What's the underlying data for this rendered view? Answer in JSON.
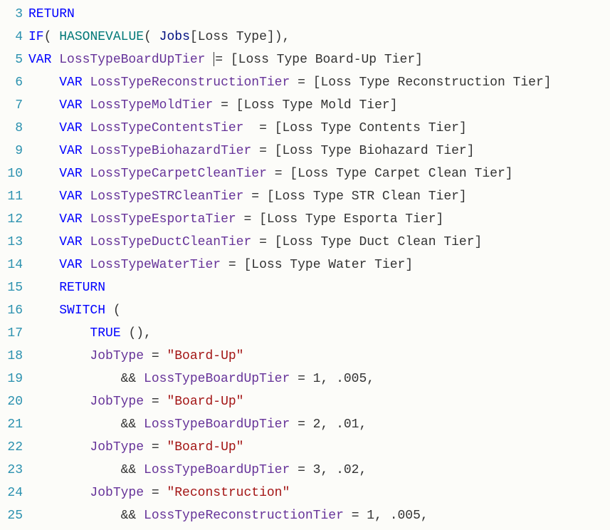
{
  "chart_data": null,
  "lines": [
    {
      "num": "3",
      "indent": 0,
      "tokens": [
        {
          "t": "RETURN",
          "c": "returnkw"
        }
      ]
    },
    {
      "num": "4",
      "indent": 0,
      "tokens": [
        {
          "t": "IF",
          "c": "ifkw"
        },
        {
          "t": "(",
          "c": "paren"
        },
        {
          "t": " ",
          "c": "plain"
        },
        {
          "t": "HASONEVALUE",
          "c": "hasone"
        },
        {
          "t": "( ",
          "c": "paren"
        },
        {
          "t": "Jobs",
          "c": "jobs"
        },
        {
          "t": "[Loss Type]",
          "c": "losstype"
        },
        {
          "t": "),",
          "c": "paren"
        }
      ]
    },
    {
      "num": "5",
      "indent": 0,
      "tokens": [
        {
          "t": "VAR",
          "c": "varkw"
        },
        {
          "t": " ",
          "c": "plain"
        },
        {
          "t": "LossTypeBoardUpTier",
          "c": "vname"
        },
        {
          "t": " ",
          "c": "plain"
        },
        {
          "t": "CURSOR",
          "c": "cursor"
        },
        {
          "t": "= ",
          "c": "op"
        },
        {
          "t": "[Loss Type Board-Up Tier]",
          "c": "measref"
        }
      ]
    },
    {
      "num": "6",
      "indent": 1,
      "tokens": [
        {
          "t": "VAR",
          "c": "varkw"
        },
        {
          "t": " ",
          "c": "plain"
        },
        {
          "t": "LossTypeReconstructionTier",
          "c": "vname"
        },
        {
          "t": " = ",
          "c": "op"
        },
        {
          "t": "[Loss Type Reconstruction Tier]",
          "c": "measref"
        }
      ]
    },
    {
      "num": "7",
      "indent": 1,
      "tokens": [
        {
          "t": "VAR",
          "c": "varkw"
        },
        {
          "t": " ",
          "c": "plain"
        },
        {
          "t": "LossTypeMoldTier",
          "c": "vname"
        },
        {
          "t": " = ",
          "c": "op"
        },
        {
          "t": "[Loss Type Mold Tier]",
          "c": "measref"
        }
      ]
    },
    {
      "num": "8",
      "indent": 1,
      "tokens": [
        {
          "t": "VAR",
          "c": "varkw"
        },
        {
          "t": " ",
          "c": "plain"
        },
        {
          "t": "LossTypeContentsTier",
          "c": "vname"
        },
        {
          "t": "  = ",
          "c": "op"
        },
        {
          "t": "[Loss Type Contents Tier]",
          "c": "measref"
        }
      ]
    },
    {
      "num": "9",
      "indent": 1,
      "tokens": [
        {
          "t": "VAR",
          "c": "varkw"
        },
        {
          "t": " ",
          "c": "plain"
        },
        {
          "t": "LossTypeBiohazardTier",
          "c": "vname"
        },
        {
          "t": " = ",
          "c": "op"
        },
        {
          "t": "[Loss Type Biohazard Tier]",
          "c": "measref"
        }
      ]
    },
    {
      "num": "10",
      "indent": 1,
      "tokens": [
        {
          "t": "VAR",
          "c": "varkw"
        },
        {
          "t": " ",
          "c": "plain"
        },
        {
          "t": "LossTypeCarpetCleanTier",
          "c": "vname"
        },
        {
          "t": " = ",
          "c": "op"
        },
        {
          "t": "[Loss Type Carpet Clean Tier]",
          "c": "measref"
        }
      ]
    },
    {
      "num": "11",
      "indent": 1,
      "tokens": [
        {
          "t": "VAR",
          "c": "varkw"
        },
        {
          "t": " ",
          "c": "plain"
        },
        {
          "t": "LossTypeSTRCleanTier",
          "c": "vname"
        },
        {
          "t": " = ",
          "c": "op"
        },
        {
          "t": "[Loss Type STR Clean Tier]",
          "c": "measref"
        }
      ]
    },
    {
      "num": "12",
      "indent": 1,
      "tokens": [
        {
          "t": "VAR",
          "c": "varkw"
        },
        {
          "t": " ",
          "c": "plain"
        },
        {
          "t": "LossTypeEsportaTier",
          "c": "vname"
        },
        {
          "t": " = ",
          "c": "op"
        },
        {
          "t": "[Loss Type Esporta Tier]",
          "c": "measref"
        }
      ]
    },
    {
      "num": "13",
      "indent": 1,
      "tokens": [
        {
          "t": "VAR",
          "c": "varkw"
        },
        {
          "t": " ",
          "c": "plain"
        },
        {
          "t": "LossTypeDuctCleanTier",
          "c": "vname"
        },
        {
          "t": " = ",
          "c": "op"
        },
        {
          "t": "[Loss Type Duct Clean Tier]",
          "c": "measref"
        }
      ]
    },
    {
      "num": "14",
      "indent": 1,
      "tokens": [
        {
          "t": "VAR",
          "c": "varkw"
        },
        {
          "t": " ",
          "c": "plain"
        },
        {
          "t": "LossTypeWaterTier",
          "c": "vname"
        },
        {
          "t": " = ",
          "c": "op"
        },
        {
          "t": "[Loss Type Water Tier]",
          "c": "measref"
        }
      ]
    },
    {
      "num": "15",
      "indent": 1,
      "tokens": [
        {
          "t": "RETURN",
          "c": "returnkw"
        }
      ]
    },
    {
      "num": "16",
      "indent": 1,
      "tokens": [
        {
          "t": "SWITCH",
          "c": "switchkw"
        },
        {
          "t": " (",
          "c": "paren"
        }
      ]
    },
    {
      "num": "17",
      "indent": 2,
      "tokens": [
        {
          "t": "TRUE",
          "c": "truekw"
        },
        {
          "t": " (),",
          "c": "paren"
        }
      ]
    },
    {
      "num": "18",
      "indent": 2,
      "tokens": [
        {
          "t": "JobType",
          "c": "jobtype"
        },
        {
          "t": " = ",
          "c": "op"
        },
        {
          "t": "\"Board-Up\"",
          "c": "str"
        }
      ]
    },
    {
      "num": "19",
      "indent": 3,
      "tokens": [
        {
          "t": "&& ",
          "c": "op"
        },
        {
          "t": "LossTypeBoardUpTier",
          "c": "vname"
        },
        {
          "t": " = 1, .005,",
          "c": "numlit"
        }
      ]
    },
    {
      "num": "20",
      "indent": 2,
      "tokens": [
        {
          "t": "JobType",
          "c": "jobtype"
        },
        {
          "t": " = ",
          "c": "op"
        },
        {
          "t": "\"Board-Up\"",
          "c": "str"
        }
      ]
    },
    {
      "num": "21",
      "indent": 3,
      "tokens": [
        {
          "t": "&& ",
          "c": "op"
        },
        {
          "t": "LossTypeBoardUpTier",
          "c": "vname"
        },
        {
          "t": " = 2, .01,",
          "c": "numlit"
        }
      ]
    },
    {
      "num": "22",
      "indent": 2,
      "tokens": [
        {
          "t": "JobType",
          "c": "jobtype"
        },
        {
          "t": " = ",
          "c": "op"
        },
        {
          "t": "\"Board-Up\"",
          "c": "str"
        }
      ]
    },
    {
      "num": "23",
      "indent": 3,
      "tokens": [
        {
          "t": "&& ",
          "c": "op"
        },
        {
          "t": "LossTypeBoardUpTier",
          "c": "vname"
        },
        {
          "t": " = 3, .02,",
          "c": "numlit"
        }
      ]
    },
    {
      "num": "24",
      "indent": 2,
      "tokens": [
        {
          "t": "JobType",
          "c": "jobtype"
        },
        {
          "t": " = ",
          "c": "op"
        },
        {
          "t": "\"Reconstruction\"",
          "c": "str"
        }
      ]
    },
    {
      "num": "25",
      "indent": 3,
      "tokens": [
        {
          "t": "&& ",
          "c": "op"
        },
        {
          "t": "LossTypeReconstructionTier",
          "c": "vname"
        },
        {
          "t": " = 1, .005,",
          "c": "numlit"
        }
      ]
    }
  ],
  "indent_unit": "    "
}
